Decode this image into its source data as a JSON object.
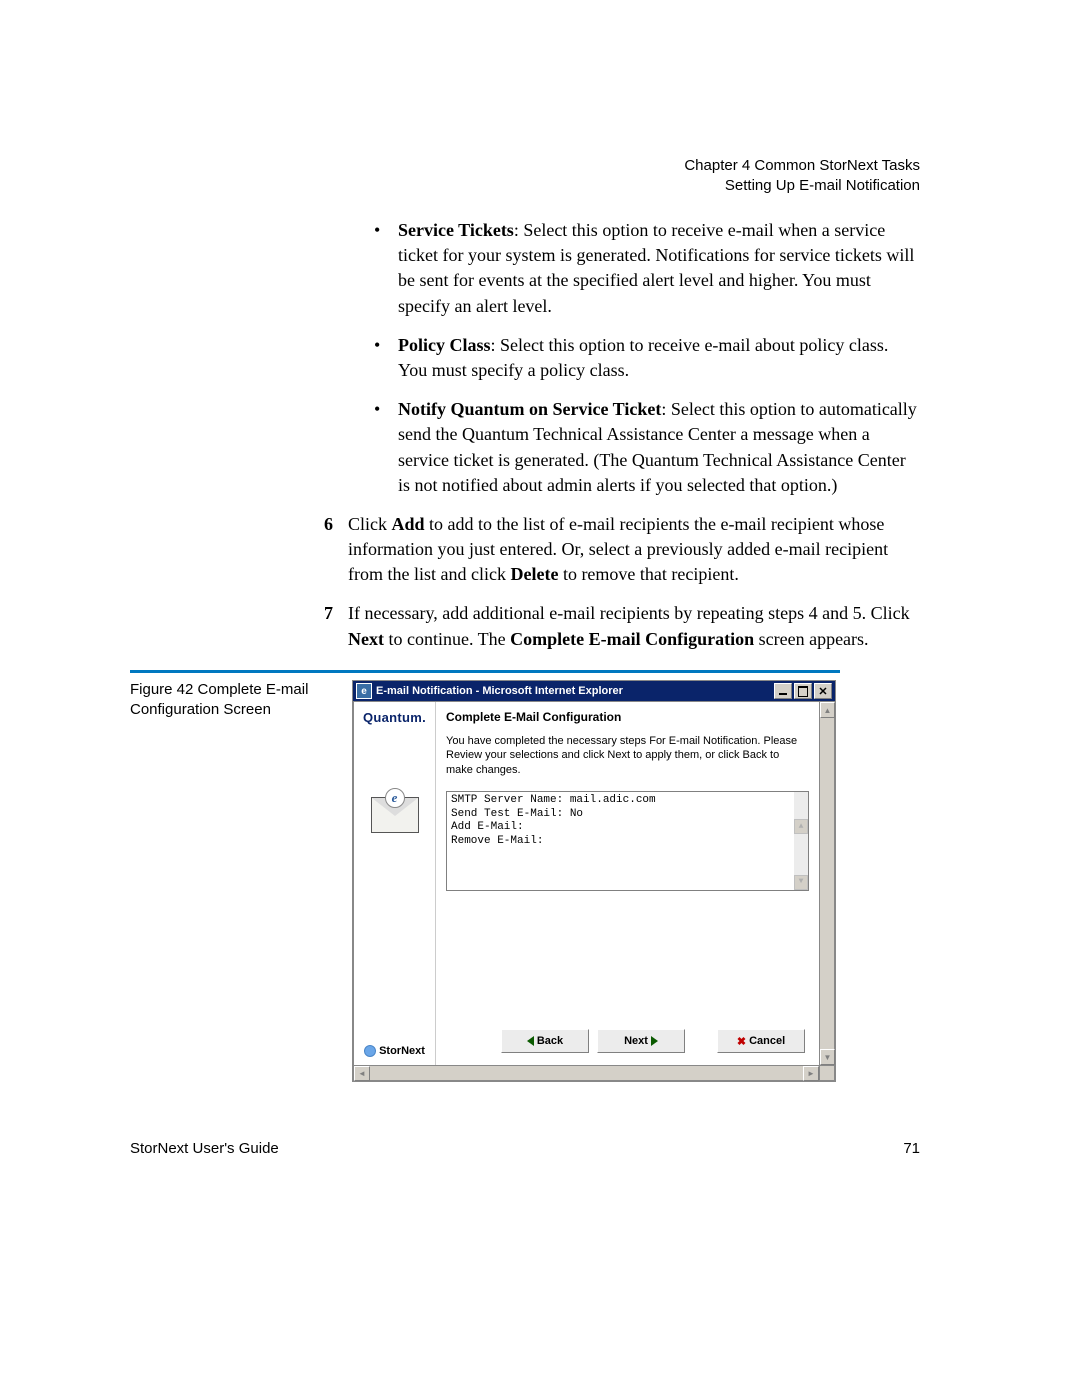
{
  "header": {
    "chapter": "Chapter 4  Common StorNext Tasks",
    "section": "Setting Up E-mail Notification"
  },
  "body": {
    "bullet1_bold": "Service Tickets",
    "bullet1_text": ": Select this option to receive e-mail when a service ticket for your system is generated. Notifications for service tickets will be sent for events at the specified alert level and higher. You must specify an alert level.",
    "bullet2_bold": "Policy Class",
    "bullet2_text": ": Select this option to receive e-mail about policy class. You must specify a policy class.",
    "bullet3_bold": "Notify Quantum on Service Ticket",
    "bullet3_text": ": Select this option to automatically send the Quantum Technical Assistance Center a message when a service ticket is generated. (The Quantum Technical Assistance Center is not notified about admin alerts if you selected that option.)",
    "step6_num": "6",
    "step6_a": "Click ",
    "step6_b": "Add",
    "step6_c": " to add to the list of e-mail recipients the e-mail recipient whose information you just entered. Or, select a previously added e-mail recipient from the list and click ",
    "step6_d": "Delete",
    "step6_e": " to remove that recipient.",
    "step7_num": "7",
    "step7_a": "If necessary, add additional e-mail recipients by repeating steps 4 and 5. Click ",
    "step7_b": "Next",
    "step7_c": " to continue. The ",
    "step7_d": "Complete E-mail Configuration",
    "step7_e": " screen appears."
  },
  "figure": {
    "label": "Figure 42  Complete E-mail Configuration Screen"
  },
  "window": {
    "title": "E-mail Notification - Microsoft Internet Explorer",
    "sidebar_brand": "Quantum.",
    "sidebar_product": "StorNext",
    "content_title": "Complete E-Mail Configuration",
    "content_desc": "You have completed the necessary steps For E-mail Notification. Please Review your selections and click Next to apply them, or click Back to make changes.",
    "summary": "SMTP Server Name: mail.adic.com\nSend Test E-Mail: No\nAdd E-Mail:\nRemove E-Mail:",
    "buttons": {
      "back": "Back",
      "next": "Next",
      "cancel": "Cancel"
    }
  },
  "footer": {
    "left": "StorNext User's Guide",
    "page": "71"
  }
}
